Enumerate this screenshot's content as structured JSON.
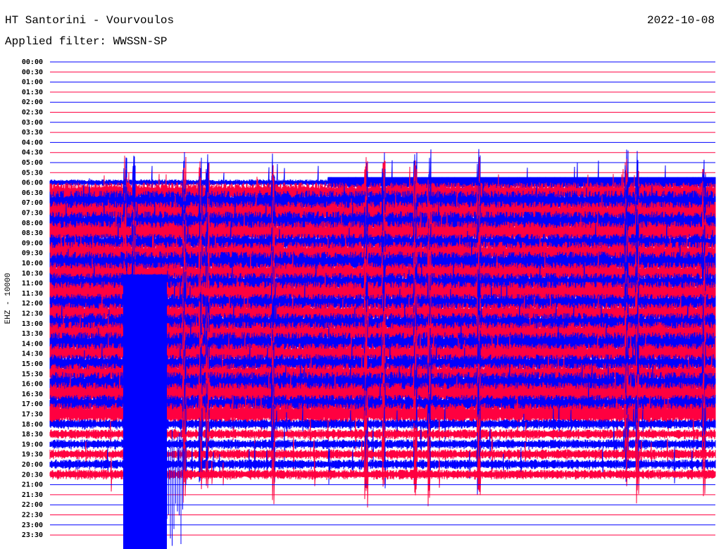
{
  "header": {
    "station": "HT Santorini - Vourvoulos",
    "date": "2022-10-08",
    "filter": "Applied filter: WWSSN-SP"
  },
  "chart_data": {
    "type": "line",
    "title": "HT Santorini - Vourvoulos",
    "ylabel": "EHZ - 10000",
    "ytick_labels": [
      "00:00",
      "00:30",
      "01:00",
      "01:30",
      "02:00",
      "02:30",
      "03:00",
      "03:30",
      "04:00",
      "04:30",
      "05:00",
      "05:30",
      "06:00",
      "06:30",
      "07:00",
      "07:30",
      "08:00",
      "08:30",
      "09:00",
      "09:30",
      "10:00",
      "10:30",
      "11:00",
      "11:30",
      "12:00",
      "12:30",
      "13:00",
      "13:30",
      "14:00",
      "14:30",
      "15:00",
      "15:30",
      "16:00",
      "16:30",
      "17:00",
      "17:30",
      "18:00",
      "18:30",
      "19:00",
      "19:30",
      "20:00",
      "20:30",
      "21:00",
      "21:30",
      "22:00",
      "22:30",
      "23:00",
      "23:30"
    ],
    "trace_colors": [
      "#0000ff",
      "#ff0040"
    ],
    "first_active_row": "06:00",
    "last_active_row": "20:30"
  }
}
